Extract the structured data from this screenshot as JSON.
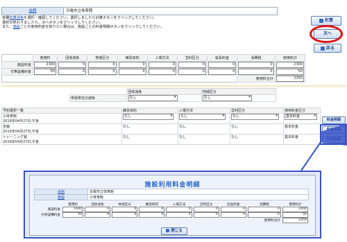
{
  "header": {
    "facility_label": "会館",
    "facility_name": "日電市立体育館"
  },
  "instructions": {
    "line1_a": "各種",
    "line1_link": "加算減免",
    "line1_b": "を選択・確認してください。選択しましたら計算ボタンをクリックしてください。",
    "line2": "選択が終わりましたら、次へボタンをクリックしてください。",
    "line3_a": "また、",
    "line3_link": "施設",
    "line3_b": "ごとの使用料金を知りたい場合は、施設ごとの料金明細ボタンをクリックしてください。"
  },
  "buttons": {
    "calc": "計算",
    "next": "次へ",
    "back": "戻る",
    "close": "閉じる",
    "detail": "料金明細"
  },
  "fee_grid": {
    "columns": [
      "使用料",
      "団体減免",
      "地域区分",
      "練習目的",
      "入場方法",
      "営利区分",
      "延長料金",
      "消費税",
      "使用料計"
    ],
    "rows": [
      {
        "label": "施設料金",
        "values": [
          "2300",
          "0",
          "0",
          "0",
          "0",
          "0",
          "0",
          "0",
          "2300"
        ]
      },
      {
        "label": "付帯設備料金",
        "values": [
          "50",
          "0",
          "0",
          "0",
          "0",
          "0",
          "0",
          "0",
          "50"
        ]
      }
    ],
    "total_label": "使用料合計",
    "total_value": "2350"
  },
  "reduction": {
    "col1": "団体減免",
    "col2": "地域区分",
    "row_label": "申請単位の減免",
    "sel1": "なし",
    "sel2": "なし"
  },
  "reservations": {
    "headers": [
      "予約選択一覧",
      "練習目的",
      "入場方法",
      "営利区分",
      "使用料金区分"
    ],
    "rows": [
      {
        "name": "小体育館",
        "date": "2016年04月27日,午後",
        "purpose": "なし",
        "entry": "なし",
        "profit": "なし",
        "fee_class": "基本料金"
      },
      {
        "name": "全面",
        "date": "2016年04月27日,午後",
        "purpose": "なし",
        "entry": "なし",
        "profit": "なし",
        "fee_class": "基本料金"
      },
      {
        "name": "トレーニング室",
        "date": "2016年04月27日,午後",
        "purpose": "なし",
        "entry": "なし",
        "profit": "なし",
        "fee_class": "基本料金"
      }
    ]
  },
  "modal": {
    "title": "施設利用料金明細",
    "facility_label": "会館",
    "facility_value": "日電市立体育館",
    "room_label": "施設",
    "room_value": "小体育館",
    "columns": [
      "使用料",
      "団体減免",
      "地域区分",
      "練習目的",
      "入場方法",
      "営利区分",
      "延長料金",
      "消費税",
      "使用料計"
    ],
    "rows": [
      {
        "label": "施設料金",
        "values": [
          "1000",
          "0",
          "0",
          "0",
          "0",
          "0",
          "0",
          "0",
          "1000"
        ]
      },
      {
        "label": "付帯設備料金",
        "values": [
          "50",
          "0",
          "0",
          "0",
          "0",
          "0",
          "0",
          "0",
          "50"
        ]
      }
    ],
    "total_label": "使用料合計",
    "total_value": "1050"
  },
  "colors": {
    "link": "#1a4ab0",
    "highlight_ring": "#e01010",
    "modal_border": "#3a52c8",
    "modal_title": "#2a66c8"
  }
}
